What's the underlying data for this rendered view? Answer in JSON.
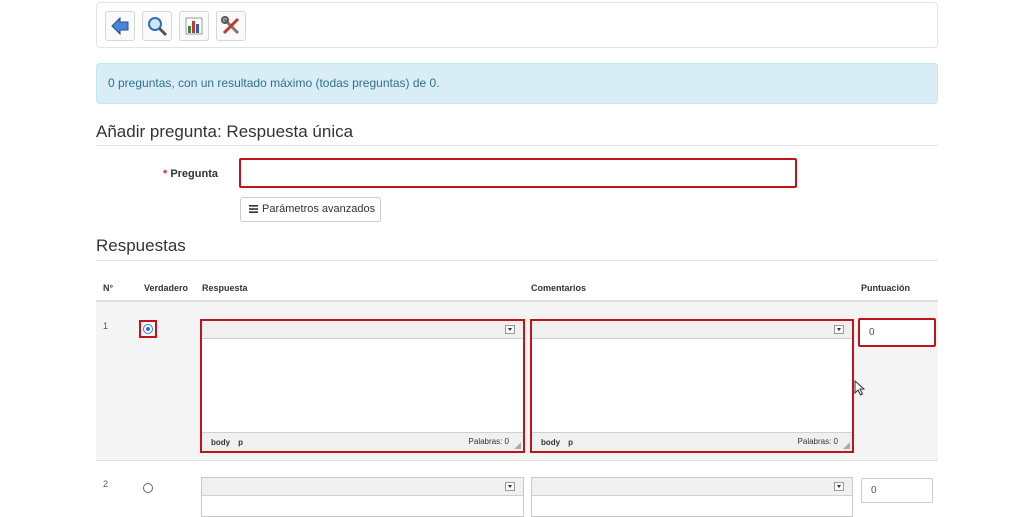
{
  "toolbar": {
    "buttons": [
      {
        "name": "back",
        "icon": "back-arrow-icon"
      },
      {
        "name": "preview",
        "icon": "magnifier-icon"
      },
      {
        "name": "results",
        "icon": "bar-chart-icon"
      },
      {
        "name": "settings",
        "icon": "tools-icon"
      }
    ]
  },
  "info": {
    "text": "0 preguntas, con un resultado máximo (todas preguntas) de 0."
  },
  "form": {
    "title": "Añadir pregunta: Respuesta única",
    "pregunta_required_mark": "*",
    "pregunta_label": "Pregunta",
    "pregunta_value": "",
    "advanced_button": "Parámetros avanzados"
  },
  "answers": {
    "title": "Respuestas",
    "headers": {
      "num": "N°",
      "correct": "Verdadero",
      "answer": "Respuesta",
      "comments": "Comentarios",
      "score": "Puntuación"
    },
    "editor_path": [
      "body",
      "p"
    ],
    "words_label": "Palabras: 0",
    "rows": [
      {
        "num": "1",
        "selected": true,
        "score": "0"
      },
      {
        "num": "2",
        "selected": false,
        "score": "0"
      }
    ]
  },
  "colors": {
    "error_border": "#c0141b",
    "info_bg": "#d9edf7",
    "info_text": "#31708f"
  }
}
